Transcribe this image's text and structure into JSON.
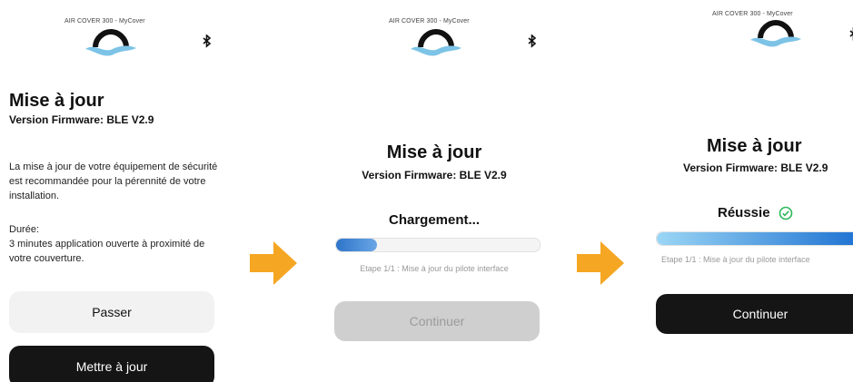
{
  "colors": {
    "accent_arrow": "#f5a623",
    "success": "#2eb85c",
    "progress": "#1b6fd1",
    "dark_button": "#151515"
  },
  "screens": [
    {
      "brand": "AIR COVER 300 - MyCover",
      "title": "Mise à jour",
      "subtitle": "Version Firmware: BLE V2.9",
      "body": "La mise à jour de votre équipement de sécurité est recommandée pour la pérennité de votre installation.",
      "duration_label": "Durée:",
      "duration_text": "3 minutes application ouverte à proximité de votre couverture.",
      "skip_button": "Passer",
      "update_button": "Mettre à jour"
    },
    {
      "brand": "AIR COVER 300 - MyCover",
      "title": "Mise à jour",
      "subtitle": "Version Firmware: BLE V2.9",
      "status": "Chargement...",
      "progress": 0.2,
      "step": "Etape 1/1 : Mise à jour du pilote interface",
      "continue_button": "Continuer"
    },
    {
      "brand": "AIR COVER 300 - MyCover",
      "title": "Mise à jour",
      "subtitle": "Version Firmware: BLE V2.9",
      "status": "Réussie",
      "progress": 1.0,
      "step": "Etape 1/1 : Mise à jour du pilote interface",
      "continue_button": "Continuer"
    }
  ],
  "icons": {
    "bluetooth": "bluetooth-icon",
    "check": "check-circle-icon",
    "arrow": "arrow-right-icon",
    "logo": "mycover-logo-icon"
  }
}
